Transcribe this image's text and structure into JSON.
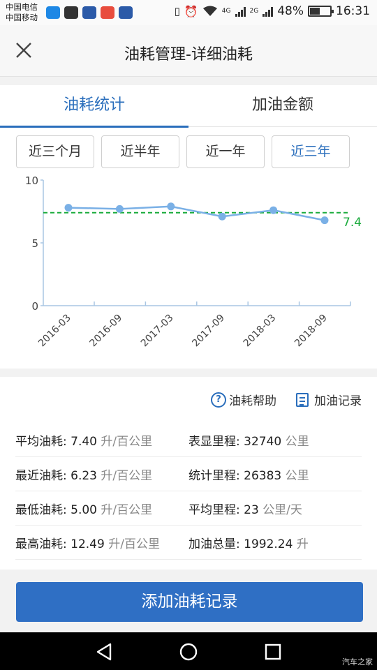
{
  "statusbar": {
    "carrier1": "中国电信",
    "carrier2": "中国移动",
    "net1": "4G",
    "net2": "2G",
    "battery": "48%",
    "time": "16:31"
  },
  "header": {
    "title": "油耗管理-详细油耗"
  },
  "tabs": [
    {
      "label": "油耗统计",
      "active": true
    },
    {
      "label": "加油金额",
      "active": false
    }
  ],
  "filters": [
    {
      "label": "近三个月",
      "active": false
    },
    {
      "label": "近半年",
      "active": false
    },
    {
      "label": "近一年",
      "active": false
    },
    {
      "label": "近三年",
      "active": true
    }
  ],
  "chart_data": {
    "type": "line",
    "x": [
      "2016-03",
      "2016-09",
      "2017-03",
      "2017-09",
      "2018-03",
      "2018-09"
    ],
    "y": [
      7.8,
      7.7,
      7.9,
      7.1,
      7.6,
      6.8
    ],
    "ylim": [
      0,
      10
    ],
    "yticks": [
      "0",
      "5",
      "10"
    ],
    "average_line": 7.4,
    "average_label": "7.4",
    "colors": {
      "line": "#7ab0e6",
      "average": "#1aab3c",
      "axis": "#a9c6e3"
    }
  },
  "links": {
    "help": "油耗帮助",
    "records": "加油记录"
  },
  "stats": [
    [
      {
        "label": "平均油耗:",
        "value": "7.40",
        "unit": "升/百公里"
      },
      {
        "label": "表显里程:",
        "value": "32740",
        "unit": "公里"
      }
    ],
    [
      {
        "label": "最近油耗:",
        "value": "6.23",
        "unit": "升/百公里"
      },
      {
        "label": "统计里程:",
        "value": "26383",
        "unit": "公里"
      }
    ],
    [
      {
        "label": "最低油耗:",
        "value": "5.00",
        "unit": "升/百公里"
      },
      {
        "label": "平均里程:",
        "value": "23",
        "unit": "公里/天"
      }
    ],
    [
      {
        "label": "最高油耗:",
        "value": "12.49",
        "unit": "升/百公里"
      },
      {
        "label": "加油总量:",
        "value": "1992.24",
        "unit": "升"
      }
    ]
  ],
  "add_button": "添加油耗记录",
  "watermark": "汽车之家",
  "colors": {
    "accent": "#2a6ebc",
    "button": "#2f6fc4"
  }
}
